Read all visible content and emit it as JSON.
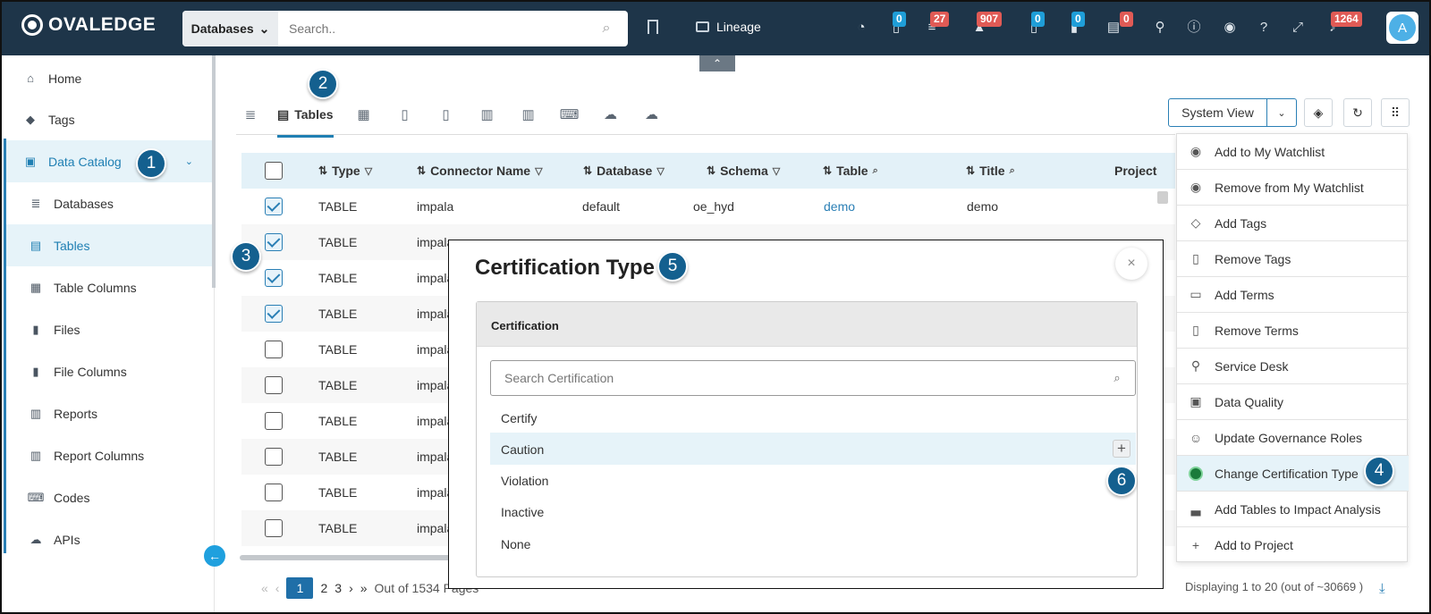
{
  "app": {
    "brand": "OVALEDGE"
  },
  "header": {
    "search_scope": "Databases",
    "search_placeholder": "Search..",
    "lineage_label": "Lineage",
    "badges": [
      "0",
      "27",
      "907",
      "0",
      "0",
      "0",
      "1264"
    ],
    "avatar_initial": "A"
  },
  "sidebar": {
    "items": [
      {
        "label": "Home",
        "icon": "home-icon"
      },
      {
        "label": "Tags",
        "icon": "tag-icon"
      },
      {
        "label": "Data Catalog",
        "icon": "catalog-icon"
      },
      {
        "label": "Databases",
        "icon": "database-icon"
      },
      {
        "label": "Tables",
        "icon": "table-icon"
      },
      {
        "label": "Table Columns",
        "icon": "columns-icon"
      },
      {
        "label": "Files",
        "icon": "file-icon"
      },
      {
        "label": "File Columns",
        "icon": "file-columns-icon"
      },
      {
        "label": "Reports",
        "icon": "report-icon"
      },
      {
        "label": "Report Columns",
        "icon": "report-columns-icon"
      },
      {
        "label": "Codes",
        "icon": "code-icon"
      },
      {
        "label": "APIs",
        "icon": "api-icon"
      }
    ],
    "toggle_icon": "←"
  },
  "tabs": {
    "active": "Tables"
  },
  "toolbar": {
    "view_label": "System View"
  },
  "table": {
    "headers": [
      "Type",
      "Connector Name",
      "Database",
      "Schema",
      "Table",
      "Title",
      "Project"
    ],
    "rows": [
      {
        "checked": true,
        "type": "TABLE",
        "connector": "impala",
        "database": "default",
        "schema": "oe_hyd",
        "table": "demo",
        "title": "demo"
      },
      {
        "checked": true,
        "type": "TABLE",
        "connector": "impala"
      },
      {
        "checked": true,
        "type": "TABLE",
        "connector": "impala"
      },
      {
        "checked": true,
        "type": "TABLE",
        "connector": "impala"
      },
      {
        "checked": false,
        "type": "TABLE",
        "connector": "impala"
      },
      {
        "checked": false,
        "type": "TABLE",
        "connector": "impala"
      },
      {
        "checked": false,
        "type": "TABLE",
        "connector": "impala"
      },
      {
        "checked": false,
        "type": "TABLE",
        "connector": "impala"
      },
      {
        "checked": false,
        "type": "TABLE",
        "connector": "impala"
      },
      {
        "checked": false,
        "type": "TABLE",
        "connector": "impala"
      }
    ]
  },
  "pagination": {
    "current": "1",
    "pages": [
      "2",
      "3"
    ],
    "out_of": "Out of 1534 Pages",
    "display": "Displaying 1 to 20  (out of ~30669 )"
  },
  "action_menu": [
    "Add to My Watchlist",
    "Remove from My Watchlist",
    "Add Tags",
    "Remove Tags",
    "Add Terms",
    "Remove Terms",
    "Service Desk",
    "Data Quality",
    "Update Governance Roles",
    "Change Certification Type",
    "Add Tables to Impact Analysis",
    "Add to Project"
  ],
  "modal": {
    "title": "Certification Type",
    "panel_header": "Certification",
    "search_placeholder": "Search Certification",
    "options": [
      "Certify",
      "Caution",
      "Violation",
      "Inactive",
      "None"
    ],
    "close_icon": "×"
  },
  "callouts": [
    "1",
    "2",
    "3",
    "4",
    "5",
    "6"
  ],
  "colors": {
    "header_bg": "#1e3549",
    "accent": "#1f7fb3",
    "callout": "#14608f",
    "badge_blue": "#1f9ed8",
    "badge_red": "#e05a55"
  }
}
